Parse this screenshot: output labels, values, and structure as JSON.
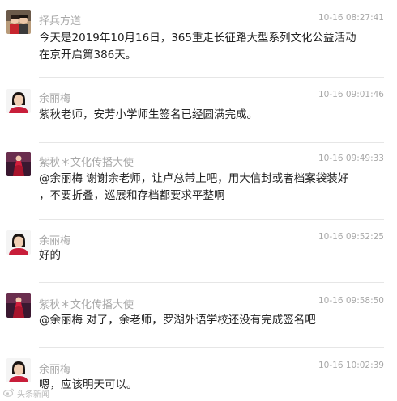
{
  "messages": [
    {
      "sender": "择兵方道",
      "time": "10-16 08:27:41",
      "avatar": "couple-photo",
      "lines": [
        "今天是2019年10月16日，365重走长征路大型系列文化公益活动",
        "在京开启第386天。"
      ]
    },
    {
      "sender": "余丽梅",
      "time": "10-16 09:01:46",
      "avatar": "woman-portrait",
      "lines": [
        "紫秋老师，安芳小学师生签名已经圆满完成。"
      ]
    },
    {
      "sender": "紫秋＊文化传播大使",
      "time": "10-16 09:49:33",
      "avatar": "woman-red-dress",
      "lines": [
        "@余丽梅 谢谢余老师，让卢总带上吧，用大信封或者档案袋装好",
        "，不要折叠，巡展和存档都要求平整啊"
      ]
    },
    {
      "sender": "余丽梅",
      "time": "10-16 09:52:25",
      "avatar": "woman-portrait",
      "lines": [
        "好的"
      ]
    },
    {
      "sender": "紫秋＊文化传播大使",
      "time": "10-16 09:58:50",
      "avatar": "woman-red-dress",
      "lines": [
        "@余丽梅 对了，余老师，罗湖外语学校还没有完成签名吧"
      ]
    },
    {
      "sender": "余丽梅",
      "time": "10-16 10:02:39",
      "avatar": "woman-portrait",
      "lines": [
        "嗯，应该明天可以。"
      ]
    }
  ],
  "watermark": {
    "icon": "weibo-logo-icon",
    "text": "头条新闻"
  }
}
